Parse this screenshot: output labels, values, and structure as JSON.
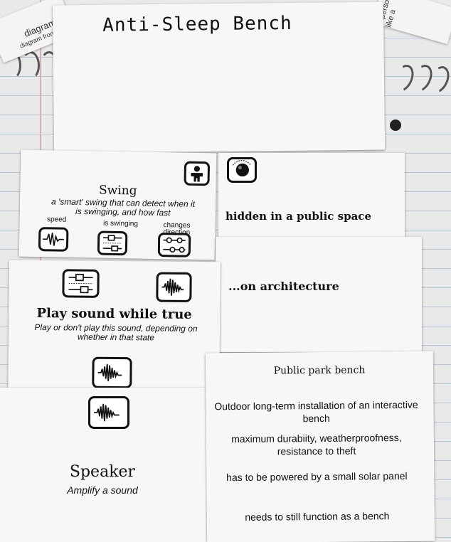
{
  "background_scraps": {
    "top_left_word": "diagram",
    "top_left_line": "diagram from the",
    "top_right_text": "a person like a"
  },
  "cards": {
    "title_card": {
      "text": "Anti-Sleep Bench"
    },
    "swing_card": {
      "title": "Swing",
      "subtitle": "a 'smart' swing that can detect when it is swinging, and how fast",
      "labels": [
        "speed",
        "is swinging",
        "changes direction"
      ],
      "icons": [
        "person-icon",
        "waveform-pulse-icon",
        "slider-stack-icon",
        "double-slider-icon"
      ]
    },
    "hidden_card": {
      "text": "hidden in a public space",
      "icon": "camera-lens-icon"
    },
    "architecture_card": {
      "text": "...on architecture"
    },
    "play_sound_card": {
      "title": "Play sound while true",
      "subtitle": "Play or don't play this sound, depending on whether in that state",
      "icons": [
        "slider-stack-icon",
        "audio-waveform-icon",
        "audio-waveform-icon"
      ]
    },
    "speaker_card": {
      "title": "Speaker",
      "subtitle": "Amplify a sound",
      "icon": "audio-waveform-icon"
    },
    "public_park_card": {
      "title": "Public park bench",
      "lines": [
        "Outdoor long-term installation of an interactive bench",
        "maximum durabiity, weatherproofness, resistance to theft",
        "has to be powered by a small solar panel",
        "needs to still function as a bench"
      ]
    }
  }
}
